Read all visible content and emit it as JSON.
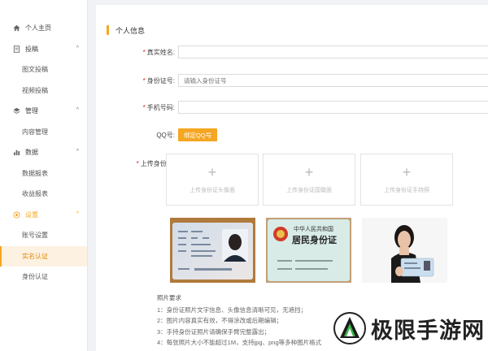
{
  "sidebar": {
    "items": [
      {
        "label": "个人主页",
        "icon": "home-icon",
        "type": "top"
      },
      {
        "label": "投稿",
        "icon": "document-icon",
        "type": "group"
      },
      {
        "label": "图文投稿",
        "type": "sub"
      },
      {
        "label": "视频投稿",
        "type": "sub"
      },
      {
        "label": "管理",
        "icon": "layers-icon",
        "type": "group"
      },
      {
        "label": "内容管理",
        "type": "sub"
      },
      {
        "label": "数据",
        "icon": "bar-chart-icon",
        "type": "group"
      },
      {
        "label": "数据报表",
        "type": "sub"
      },
      {
        "label": "收益报表",
        "type": "sub"
      },
      {
        "label": "设置",
        "icon": "settings-icon",
        "type": "group",
        "open": true
      },
      {
        "label": "账号设置",
        "type": "sub"
      },
      {
        "label": "实名认证",
        "type": "sub",
        "active": true
      },
      {
        "label": "身份认证",
        "type": "sub"
      }
    ]
  },
  "main": {
    "section_title": "个人信息",
    "fields": {
      "real_name": {
        "label": "真实姓名:",
        "value": "",
        "placeholder": ""
      },
      "id_number": {
        "label": "身份证号:",
        "value": "",
        "placeholder": "请输入身份证号"
      },
      "phone": {
        "label": "手机号码:",
        "value": "",
        "placeholder": ""
      },
      "qq": {
        "label": "QQ号:",
        "button": "绑定QQ号"
      }
    },
    "upload": {
      "label": "上传身份证:",
      "boxes": [
        "上传身份证头像面",
        "上传身份证国徽面",
        "上传身份证手持照"
      ]
    },
    "samples": {
      "front_title": "中华人民共和国",
      "back_title": "居民身份证"
    },
    "requirements": {
      "title": "照片要求",
      "lines": [
        "1：身份证照片文字信息、头像信息清晰可见，无遮挡；",
        "2：图片内容真实有效，不得涂改或后期编辑；",
        "3：手持身份证照片请确保手臂完整露出；",
        "4：每张照片大小不能超过1M，支持jpg、png等多种图片格式"
      ]
    }
  },
  "watermark": {
    "text": "极限手游网"
  },
  "colors": {
    "accent": "#f5a623",
    "required": "#e02020"
  }
}
